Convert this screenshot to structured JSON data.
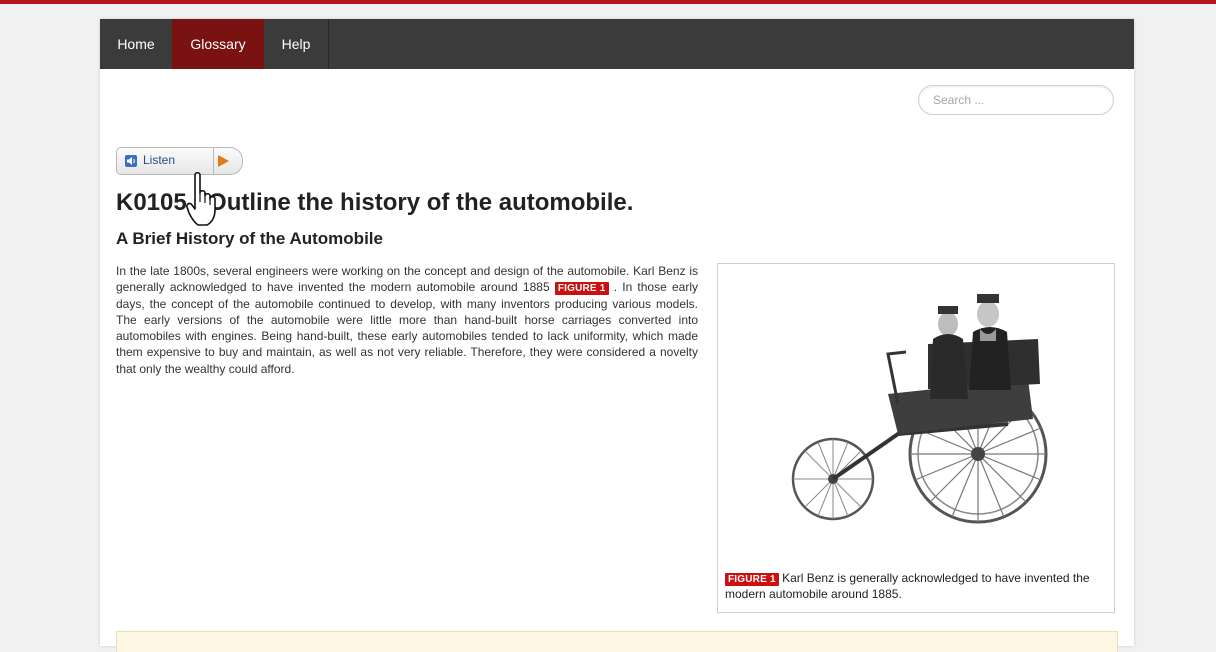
{
  "nav": {
    "items": [
      "Home",
      "Glossary",
      "Help"
    ],
    "active": "Glossary"
  },
  "search": {
    "placeholder": "Search ..."
  },
  "listen": {
    "label": "Listen"
  },
  "content": {
    "title": "K0105 - Outline the history of the automobile.",
    "subtitle": "A Brief History of the Automobile",
    "paragraph_before": "In the late 1800s, several engineers were working on the concept and design of the automobile. Karl Benz is generally acknowledged to have invented the modern automobile around 1885",
    "figure_tag": "FIGURE 1",
    "paragraph_after": ". In those early days, the concept of the automobile continued to develop, with many inventors producing various models. The early versions of the automobile were little more than hand-built horse carriages converted into automobiles with engines. Being hand-built, these early automobiles tended to lack uniformity, which made them expensive to buy and maintain, as well as not very reliable. Therefore, they were considered a novelty that only the wealthy could afford."
  },
  "figure": {
    "tag": "FIGURE 1",
    "caption": "Karl Benz is generally acknowledged to have invented the modern automobile around 1885."
  },
  "colors": {
    "accent": "#7a1212",
    "nav_bg": "#3b3b3b",
    "figure_tag": "#cc1010",
    "top_rule": "#b5161c"
  }
}
